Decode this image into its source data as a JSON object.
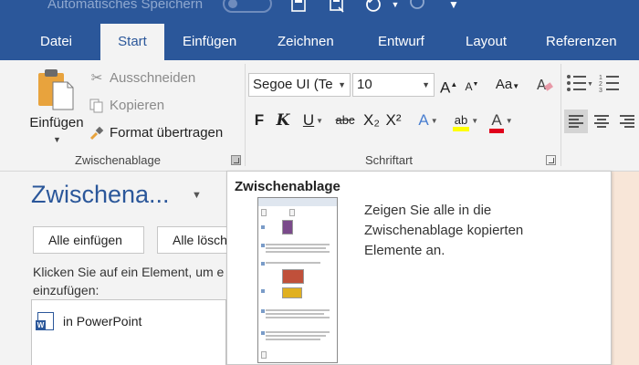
{
  "qat": {
    "autosave_label": "Automatisches Speichern",
    "save_icon": "save-icon",
    "save_as_icon": "save-as-icon",
    "undo_icon": "undo-icon",
    "redo_icon": "redo-icon",
    "customize_icon": "customize-qat-icon"
  },
  "tabs": [
    {
      "label": "Datei"
    },
    {
      "label": "Start"
    },
    {
      "label": "Einfügen"
    },
    {
      "label": "Zeichnen"
    },
    {
      "label": "Entwurf"
    },
    {
      "label": "Layout"
    },
    {
      "label": "Referenzen"
    }
  ],
  "clipboard_group": {
    "paste_label": "Einfügen",
    "cut_label": "Ausschneiden",
    "copy_label": "Kopieren",
    "format_painter_label": "Format übertragen",
    "group_label": "Zwischenablage"
  },
  "font_group": {
    "font_name": "Segoe UI (Te",
    "font_size": "10",
    "grow_label": "A",
    "shrink_label": "A",
    "case_label": "Aa",
    "bold": "F",
    "italic": "K",
    "underline": "U",
    "strike": "abc",
    "subscript": "X₂",
    "superscript": "X²",
    "effects": "A",
    "highlight": "ab",
    "font_color": "A",
    "group_label": "Schriftart"
  },
  "pane": {
    "title": "Zwischena...",
    "paste_all_label": "Alle einfügen",
    "clear_all_label": "Alle lösch",
    "help_line1": "Klicken Sie auf ein Element, um e",
    "help_line2": "einzufügen:",
    "items": [
      {
        "label": "in PowerPoint"
      }
    ]
  },
  "tooltip": {
    "title": "Zwischenablage",
    "description": "Zeigen Sie alle in die Zwischenablage kopierten Elemente an."
  },
  "colors": {
    "brand_blue": "#2b579a",
    "ribbon_bg": "#f3f3f3",
    "highlight_yellow": "#ffff00",
    "font_color_red": "#e0001b"
  }
}
